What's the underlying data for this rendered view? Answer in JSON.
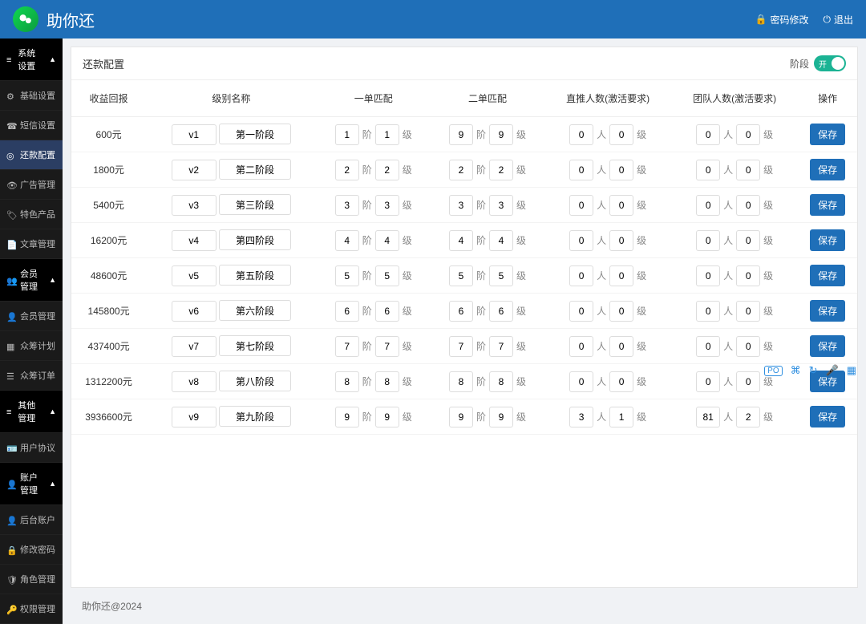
{
  "header": {
    "title": "助你还",
    "pwd": "密码修改",
    "logout": "退出"
  },
  "sidebar": [
    {
      "label": "系统设置",
      "type": "group",
      "open": true,
      "icon": "bars"
    },
    {
      "label": "基础设置",
      "icon": "gear"
    },
    {
      "label": "短信设置",
      "icon": "phone"
    },
    {
      "label": "还款配置",
      "icon": "circle",
      "active": true
    },
    {
      "label": "广告管理",
      "icon": "eye"
    },
    {
      "label": "特色产品",
      "icon": "tag"
    },
    {
      "label": "文章管理",
      "icon": "doc"
    },
    {
      "label": "会员管理",
      "type": "group",
      "open": true,
      "icon": "users"
    },
    {
      "label": "会员管理",
      "icon": "user"
    },
    {
      "label": "众筹计划",
      "icon": "grid"
    },
    {
      "label": "众筹订单",
      "icon": "list"
    },
    {
      "label": "其他管理",
      "type": "group",
      "open": true,
      "icon": "bars"
    },
    {
      "label": "用户协议",
      "icon": "card"
    },
    {
      "label": "账户管理",
      "type": "group",
      "open": true,
      "icon": "user"
    },
    {
      "label": "后台账户",
      "icon": "user"
    },
    {
      "label": "修改密码",
      "icon": "lock"
    },
    {
      "label": "角色管理",
      "icon": "shield"
    },
    {
      "label": "权限管理",
      "icon": "key"
    }
  ],
  "panel": {
    "title": "还款配置",
    "toggleLabel": "阶段",
    "toggleOn": "开"
  },
  "columns": [
    "收益回报",
    "级别名称",
    "一单匹配",
    "二单匹配",
    "直推人数(激活要求)",
    "团队人数(激活要求)",
    "操作"
  ],
  "units": {
    "jie": "阶",
    "ji": "级",
    "ren": "人",
    "currency": "元"
  },
  "saveLabel": "保存",
  "rows": [
    {
      "amount": "600",
      "lvl": "v1",
      "name": "第一阶段",
      "m1a": "1",
      "m1b": "1",
      "m2a": "9",
      "m2b": "9",
      "d1": "0",
      "d2": "0",
      "t1": "0",
      "t2": "0"
    },
    {
      "amount": "1800",
      "lvl": "v2",
      "name": "第二阶段",
      "m1a": "2",
      "m1b": "2",
      "m2a": "2",
      "m2b": "2",
      "d1": "0",
      "d2": "0",
      "t1": "0",
      "t2": "0"
    },
    {
      "amount": "5400",
      "lvl": "v3",
      "name": "第三阶段",
      "m1a": "3",
      "m1b": "3",
      "m2a": "3",
      "m2b": "3",
      "d1": "0",
      "d2": "0",
      "t1": "0",
      "t2": "0"
    },
    {
      "amount": "16200",
      "lvl": "v4",
      "name": "第四阶段",
      "m1a": "4",
      "m1b": "4",
      "m2a": "4",
      "m2b": "4",
      "d1": "0",
      "d2": "0",
      "t1": "0",
      "t2": "0"
    },
    {
      "amount": "48600",
      "lvl": "v5",
      "name": "第五阶段",
      "m1a": "5",
      "m1b": "5",
      "m2a": "5",
      "m2b": "5",
      "d1": "0",
      "d2": "0",
      "t1": "0",
      "t2": "0"
    },
    {
      "amount": "145800",
      "lvl": "v6",
      "name": "第六阶段",
      "m1a": "6",
      "m1b": "6",
      "m2a": "6",
      "m2b": "6",
      "d1": "0",
      "d2": "0",
      "t1": "0",
      "t2": "0"
    },
    {
      "amount": "437400",
      "lvl": "v7",
      "name": "第七阶段",
      "m1a": "7",
      "m1b": "7",
      "m2a": "7",
      "m2b": "7",
      "d1": "0",
      "d2": "0",
      "t1": "0",
      "t2": "0"
    },
    {
      "amount": "1312200",
      "lvl": "v8",
      "name": "第八阶段",
      "m1a": "8",
      "m1b": "8",
      "m2a": "8",
      "m2b": "8",
      "d1": "0",
      "d2": "0",
      "t1": "0",
      "t2": "0"
    },
    {
      "amount": "3936600",
      "lvl": "v9",
      "name": "第九阶段",
      "m1a": "9",
      "m1b": "9",
      "m2a": "9",
      "m2b": "9",
      "d1": "3",
      "d2": "1",
      "t1": "81",
      "t2": "2"
    }
  ],
  "footer": "助你还@2024"
}
